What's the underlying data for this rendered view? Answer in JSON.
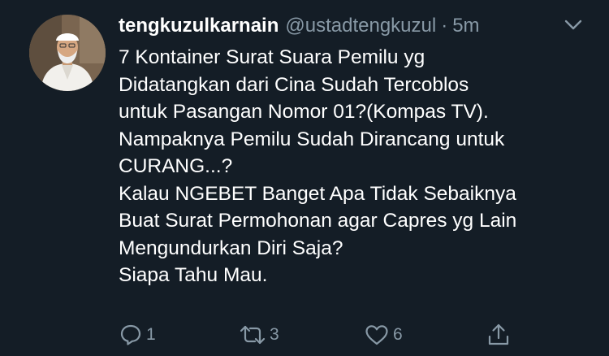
{
  "tweet": {
    "display_name": "tengkuzulkarnain",
    "handle": "@ustadtengkuzul",
    "separator": "·",
    "time": "5m",
    "lines": [
      "7 Kontainer Surat Suara Pemilu yg",
      "Didatangkan dari Cina Sudah Tercoblos",
      "untuk Pasangan Nomor 01?(Kompas TV).",
      "Nampaknya Pemilu Sudah Dirancang untuk",
      "CURANG...?",
      "Kalau NGEBET Banget Apa Tidak Sebaiknya",
      "Buat Surat Permohonan agar Capres yg Lain",
      "Mengundurkan Diri Saja?",
      "Siapa Tahu Mau."
    ],
    "actions": {
      "reply_count": "1",
      "retweet_count": "3",
      "like_count": "6"
    }
  },
  "icons": {
    "menu": "chevron-down-icon",
    "reply": "reply-icon",
    "retweet": "retweet-icon",
    "like": "heart-icon",
    "share": "share-icon"
  },
  "colors": {
    "background": "#141d26",
    "primary_text": "#ffffff",
    "secondary_text": "#8899a6"
  }
}
